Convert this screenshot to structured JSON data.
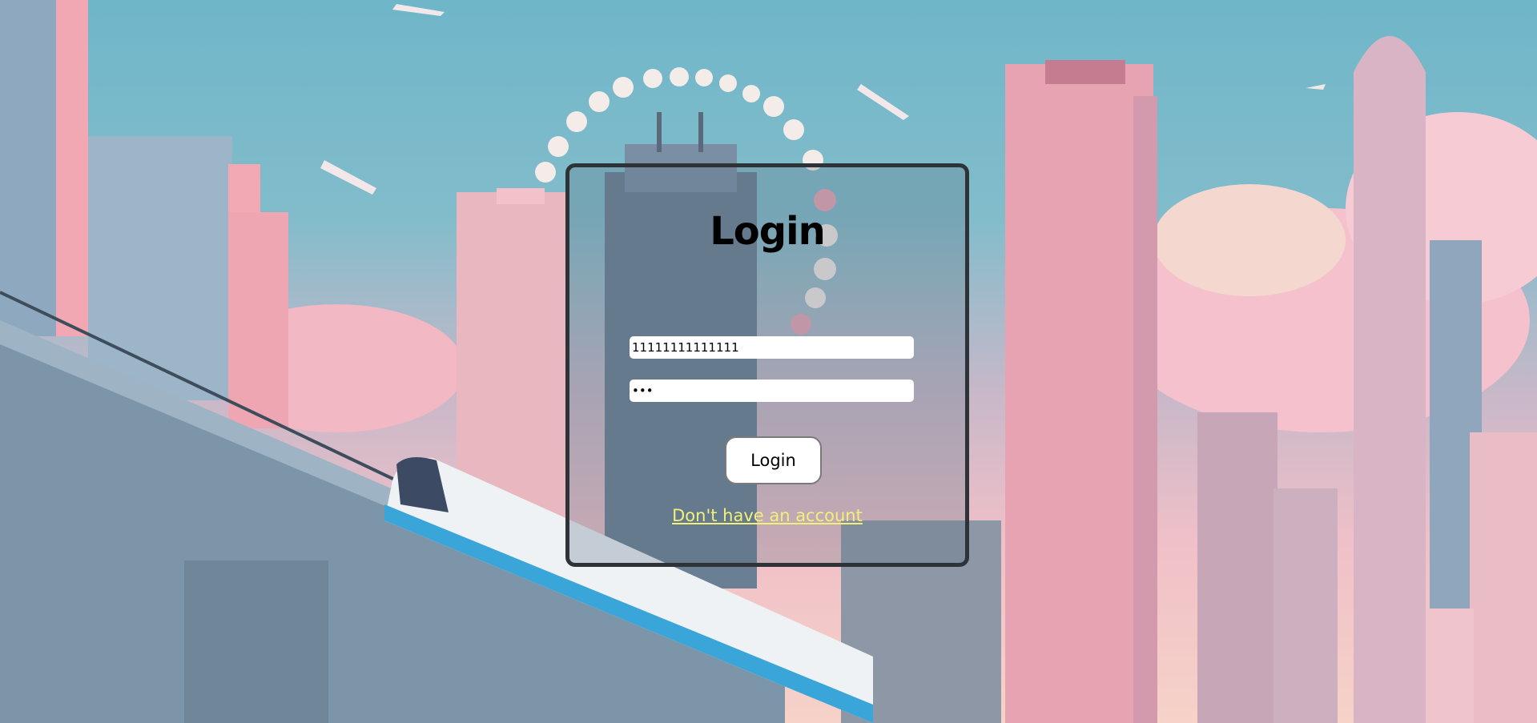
{
  "login": {
    "title": "Login",
    "username_value": "11111111111111",
    "password_value": "•••",
    "submit_label": "Login",
    "signup_link": "Don't have an account"
  },
  "colors": {
    "card_border": "#2e3338",
    "link": "#f3f07a",
    "field_bg": "#ffffff"
  }
}
